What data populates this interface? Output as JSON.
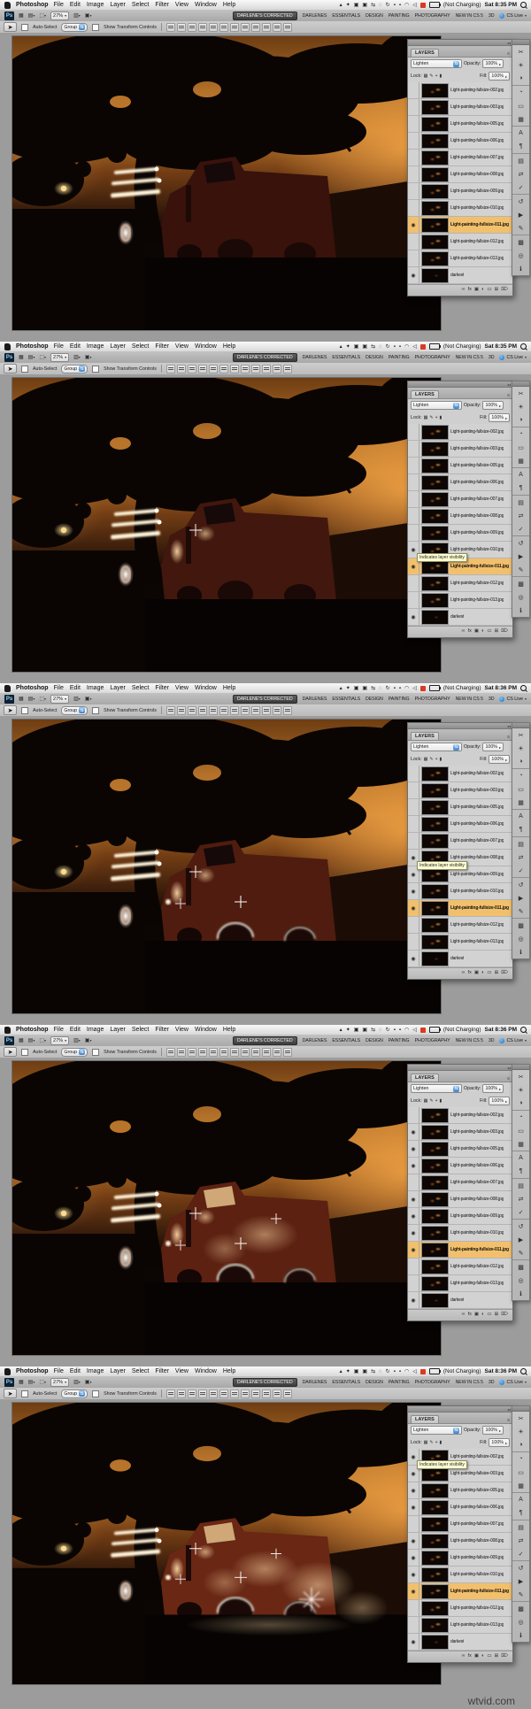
{
  "watermark": "wtvid.com",
  "menu_bar": {
    "apple_icon": "apple-logo",
    "app_name": "Photoshop",
    "items": [
      "File",
      "Edit",
      "Image",
      "Layer",
      "Select",
      "Filter",
      "View",
      "Window",
      "Help"
    ],
    "status_icons": [
      "notification",
      "widget",
      "app-box-1",
      "app-box-2",
      "arrows-sync",
      "circle-outline",
      "refresh",
      "display-1",
      "display-2",
      "wifi",
      "volume"
    ],
    "red_badge_icon": "adobe-update-red",
    "battery_icon": "battery",
    "battery_label": "(Not Charging)",
    "search_icon": "spotlight-search"
  },
  "app_bar": {
    "ps_logo": "Ps",
    "left_icons": [
      "bridge",
      "view-extras",
      "zoom-tool"
    ],
    "zoom_value": "27%",
    "right_icons": [
      "arrange-documents",
      "screen-mode"
    ],
    "workspaces": [
      "DARLENE'S CORRECTED",
      "DARLENES",
      "ESSENTIALS",
      "DESIGN",
      "PAINTING",
      "PHOTOGRAPHY",
      "NEW IN CS 5",
      "3D"
    ],
    "active_workspace": "DARLENE'S CORRECTED",
    "cs_live": "CS Live"
  },
  "options_bar": {
    "tool": "move-tool",
    "auto_select_label": "Auto-Select",
    "auto_select_value": "Group",
    "show_transform_label": "Show Transform Controls",
    "align_icon_count": 12
  },
  "layers_panel": {
    "tab": "LAYERS",
    "blend_mode": "Lighten",
    "opacity_label": "Opacity:",
    "opacity_value": "100%",
    "lock_label": "Lock:",
    "fill_label": "Fill:",
    "fill_value": "100%",
    "tooltip": "Indicates layer visibility",
    "selected_layer": "Light-painting-fullsize-011.jpg",
    "layers": [
      "Light-painting-fullsize-002.jpg",
      "Light-painting-fullsize-003.jpg",
      "Light-painting-fullsize-005.jpg",
      "Light-painting-fullsize-006.jpg",
      "Light-painting-fullsize-007.jpg",
      "Light-painting-fullsize-008.jpg",
      "Light-painting-fullsize-009.jpg",
      "Light-painting-fullsize-010.jpg",
      "Light-painting-fullsize-011.jpg",
      "Light-painting-fullsize-012.jpg",
      "Light-painting-fullsize-013.jpg",
      "darkest"
    ],
    "bottom_icons": [
      "link-layers",
      "layer-style",
      "layer-mask",
      "adjustment-layer",
      "layer-group",
      "new-layer",
      "delete-layer"
    ]
  },
  "dock_icons": [
    "color",
    "swatches",
    "styles",
    "adjustments",
    "masks",
    "histogram",
    "character",
    "paragraph",
    "layers-icon",
    "channels",
    "paths",
    "history",
    "actions",
    "tool-presets",
    "brush-presets",
    "clone-source",
    "info"
  ],
  "colors": {
    "selected_layer_highlight": "#f2c06c",
    "tooltip_bg": "#ffffd2",
    "sky_orange": "#c07a2c",
    "active_workspace_bg": "#3c3c3c",
    "cs_live_blue": "#1c6fc2"
  },
  "screenshots": [
    {
      "time": "Sat 8:35 PM",
      "stage": 1,
      "tooltip_layer": null,
      "visible_layers": [
        "Light-painting-fullsize-011.jpg",
        "darkest"
      ]
    },
    {
      "time": "Sat 8:35 PM",
      "stage": 2,
      "tooltip_layer": "Light-painting-fullsize-011.jpg",
      "visible_layers": [
        "Light-painting-fullsize-010.jpg",
        "Light-painting-fullsize-011.jpg",
        "darkest"
      ]
    },
    {
      "time": "Sat 8:36 PM",
      "stage": 3,
      "tooltip_layer": "Light-painting-fullsize-009.jpg",
      "visible_layers": [
        "Light-painting-fullsize-008.jpg",
        "Light-painting-fullsize-009.jpg",
        "Light-painting-fullsize-010.jpg",
        "Light-painting-fullsize-011.jpg",
        "darkest"
      ]
    },
    {
      "time": "Sat 8:36 PM",
      "stage": 4,
      "tooltip_layer": null,
      "visible_layers": [
        "Light-painting-fullsize-003.jpg",
        "Light-painting-fullsize-005.jpg",
        "Light-painting-fullsize-006.jpg",
        "Light-painting-fullsize-008.jpg",
        "Light-painting-fullsize-009.jpg",
        "Light-painting-fullsize-010.jpg",
        "Light-painting-fullsize-011.jpg",
        "darkest"
      ]
    },
    {
      "time": "Sat 8:36 PM",
      "stage": 5,
      "tooltip_layer": "Light-painting-fullsize-003.jpg",
      "visible_layers": [
        "Light-painting-fullsize-002.jpg",
        "Light-painting-fullsize-003.jpg",
        "Light-painting-fullsize-005.jpg",
        "Light-painting-fullsize-006.jpg",
        "Light-painting-fullsize-008.jpg",
        "Light-painting-fullsize-009.jpg",
        "Light-painting-fullsize-010.jpg",
        "Light-painting-fullsize-011.jpg",
        "darkest"
      ]
    }
  ]
}
